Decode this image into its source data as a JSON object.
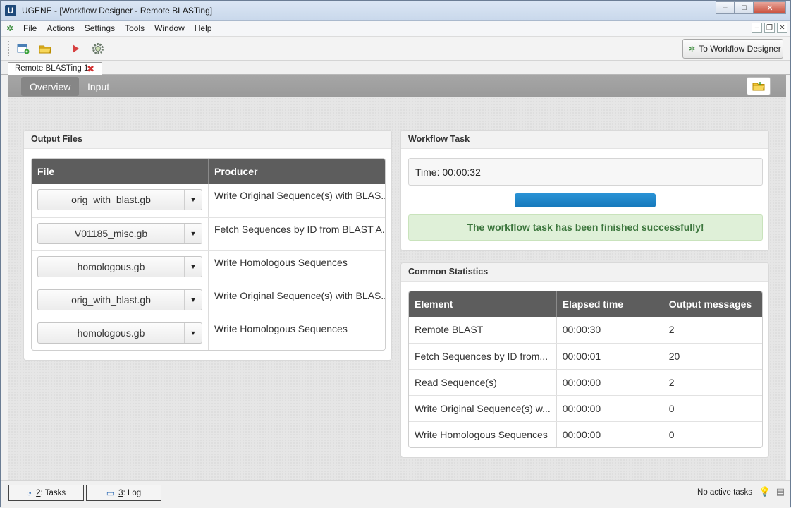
{
  "window": {
    "logo": "U",
    "title": "UGENE - [Workflow Designer - Remote BLASTing]",
    "controls": {
      "minimize": "–",
      "maximize": "□",
      "close": "✕"
    }
  },
  "menubar": {
    "items": [
      "File",
      "Actions",
      "Settings",
      "Tools",
      "Window",
      "Help"
    ],
    "mdi": {
      "minimize": "–",
      "restore": "❐",
      "close": "✕"
    }
  },
  "toolbar": {
    "to_designer_label": "To Workflow Designer"
  },
  "doc_tab": {
    "label": "Remote BLASTing 1",
    "close": "✖"
  },
  "dashboard": {
    "tabs": [
      "Overview",
      "Input"
    ],
    "output_files": {
      "title": "Output Files",
      "headers": [
        "File",
        "Producer"
      ],
      "rows": [
        {
          "file": "orig_with_blast.gb",
          "producer": "Write Original Sequence(s) with BLAS..."
        },
        {
          "file": "V01185_misc.gb",
          "producer": "Fetch Sequences by ID from BLAST A..."
        },
        {
          "file": "homologous.gb",
          "producer": "Write Homologous Sequences"
        },
        {
          "file": "orig_with_blast.gb",
          "producer": "Write Original Sequence(s) with BLAS..."
        },
        {
          "file": "homologous.gb",
          "producer": "Write Homologous Sequences"
        }
      ]
    },
    "workflow_task": {
      "title": "Workflow Task",
      "time": "Time: 00:00:32",
      "progress": 1.0,
      "status": "The workflow task has been finished successfully!"
    },
    "common_statistics": {
      "title": "Common Statistics",
      "headers": [
        "Element",
        "Elapsed time",
        "Output messages"
      ],
      "rows": [
        [
          "Remote BLAST",
          "00:00:30",
          "2"
        ],
        [
          "Fetch Sequences by ID from...",
          "00:00:01",
          "20"
        ],
        [
          "Read Sequence(s)",
          "00:00:00",
          "2"
        ],
        [
          "Write Original Sequence(s) w...",
          "00:00:00",
          "0"
        ],
        [
          "Write Homologous Sequences",
          "00:00:00",
          "0"
        ]
      ]
    }
  },
  "statusbar": {
    "tasks_key": "2",
    "tasks_label": ": Tasks",
    "log_key": "3",
    "log_label": ": Log",
    "status": "No active tasks"
  },
  "colors": {
    "header_dark": "#5d5d5d",
    "progress": "#1578bb",
    "success_bg": "#dff0d8",
    "success_text": "#3c763d"
  }
}
